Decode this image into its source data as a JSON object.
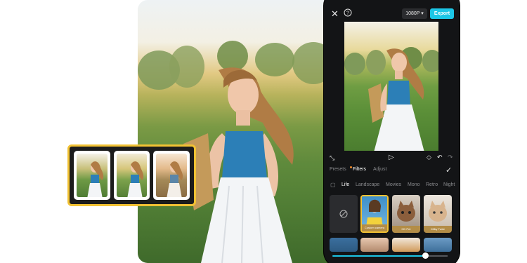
{
  "editor": {
    "resolution_label": "1080P",
    "export_label": "Export"
  },
  "panel": {
    "tabs": [
      "Presets",
      "Filters",
      "Adjust"
    ],
    "active_tab": "Filters",
    "categories": [
      "Life",
      "Landscape",
      "Movies",
      "Mono",
      "Retro",
      "Night"
    ],
    "active_category": "Life"
  },
  "filter_thumbs": [
    {
      "label": "Custom camera"
    },
    {
      "label": "HD Pet"
    },
    {
      "label": "Milky Twist"
    }
  ],
  "slider": {
    "value_percent": 0.88
  },
  "colors": {
    "accent": "#1cc6e6",
    "highlight": "#f2c233",
    "panel_bg": "#131416"
  },
  "icons": {
    "close": "close-icon",
    "help": "help-icon",
    "fullscreen": "fullscreen-icon",
    "play": "play-icon",
    "keyframe": "keyframe-icon",
    "undo": "undo-icon",
    "redo": "redo-icon",
    "check": "check-icon",
    "compare": "compare-icon",
    "none": "no-filter-icon"
  }
}
